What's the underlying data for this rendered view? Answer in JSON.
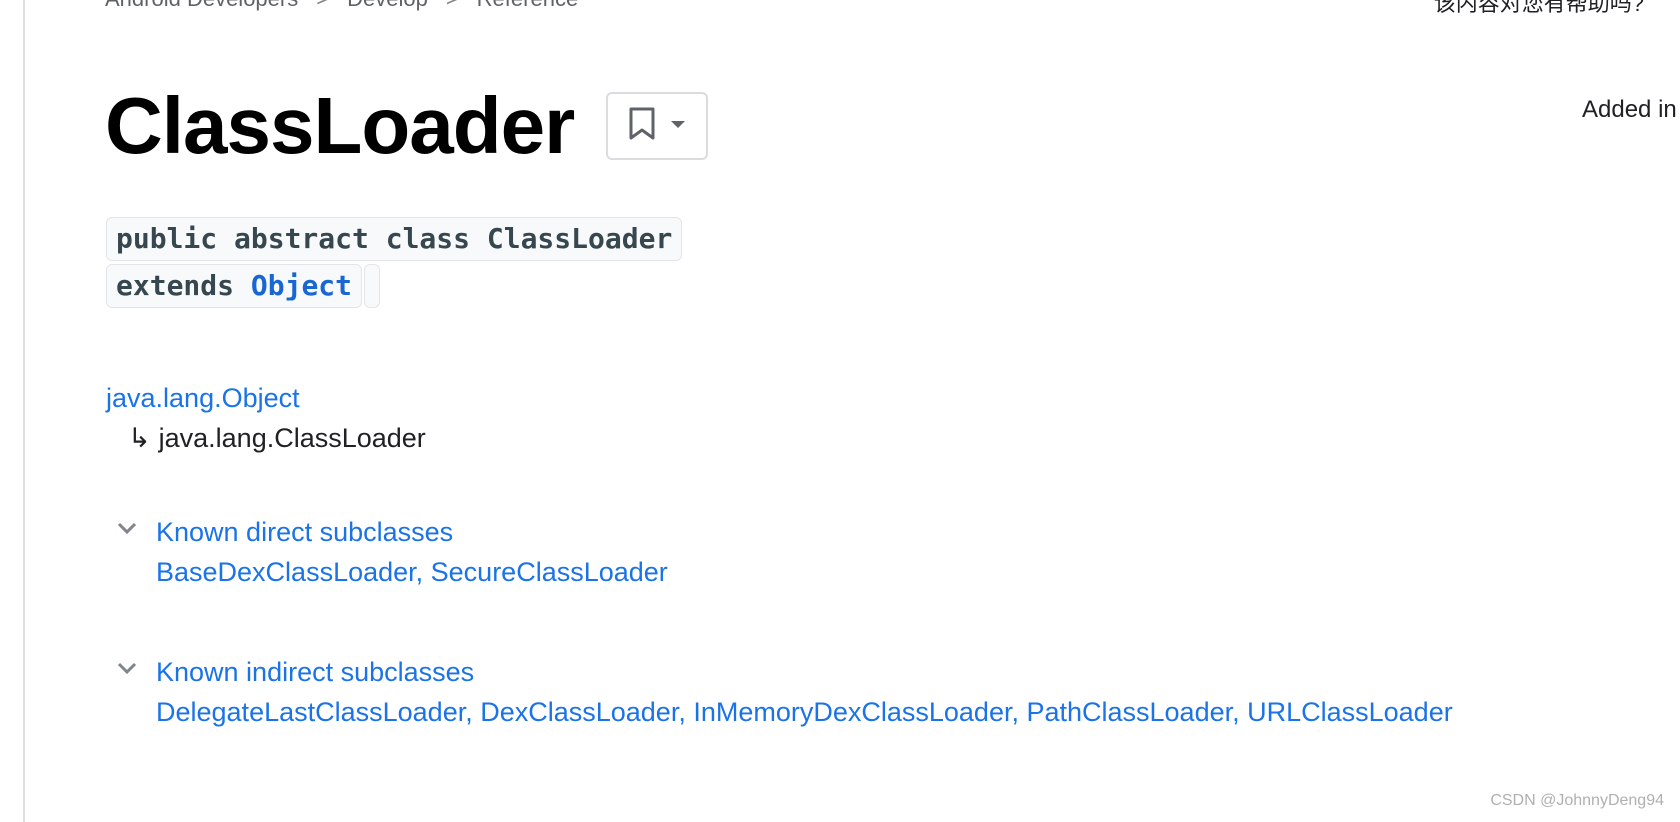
{
  "breadcrumb": {
    "items": [
      "Android Developers",
      "Develop",
      "Reference"
    ],
    "separator": ">"
  },
  "top_right_text": "该内容对您有帮助吗?",
  "title": "ClassLoader",
  "added_in": "Added in",
  "signature": {
    "line1": "public abstract class ClassLoader",
    "extends_keyword": "extends",
    "extends_link": "Object"
  },
  "hierarchy": {
    "parent": "java.lang.Object",
    "arrow": "↳",
    "child": "java.lang.ClassLoader"
  },
  "direct_subclasses": {
    "heading": "Known direct subclasses",
    "list": "BaseDexClassLoader, SecureClassLoader"
  },
  "indirect_subclasses": {
    "heading": "Known indirect subclasses",
    "list": "DelegateLastClassLoader, DexClassLoader, InMemoryDexClassLoader, PathClassLoader, URLClassLoader"
  },
  "watermark": "CSDN @JohnnyDeng94",
  "icons": {
    "bookmark": "bookmark-icon",
    "dropdown": "arrow-drop-down-icon",
    "expand": "chevron-down-icon"
  },
  "colors": {
    "link": "#1a73e8",
    "code_text": "#37474f",
    "code_bg": "#f8f9fa"
  }
}
